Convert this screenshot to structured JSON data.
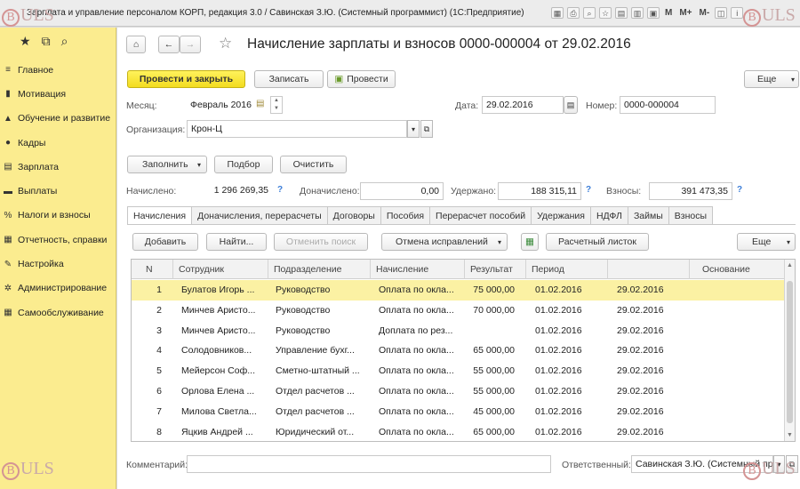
{
  "window": {
    "title": "Зарплата и управление персоналом КОРП, редакция 3.0 / Савинская З.Ю. (Системный программист)  (1С:Предприятие)",
    "toolbar_text": [
      "M",
      "M+",
      "M-"
    ]
  },
  "watermark": "ULS",
  "sidebar": {
    "items": [
      {
        "label": "Главное",
        "icon": "menu-icon"
      },
      {
        "label": "Мотивация",
        "icon": "chart-icon"
      },
      {
        "label": "Обучение и развитие",
        "icon": "graduation-icon"
      },
      {
        "label": "Кадры",
        "icon": "people-icon"
      },
      {
        "label": "Зарплата",
        "icon": "document-icon"
      },
      {
        "label": "Выплаты",
        "icon": "cash-icon"
      },
      {
        "label": "Налоги и взносы",
        "icon": "percent-icon"
      },
      {
        "label": "Отчетность, справки",
        "icon": "report-icon"
      },
      {
        "label": "Настройка",
        "icon": "wrench-icon"
      },
      {
        "label": "Администрирование",
        "icon": "gear-icon"
      },
      {
        "label": "Самообслуживание",
        "icon": "grid-icon"
      }
    ]
  },
  "header": {
    "title": "Начисление зарплаты и взносов 0000-000004 от 29.02.2016"
  },
  "actions": {
    "post_close": "Провести и закрыть",
    "save": "Записать",
    "post": "Провести",
    "more": "Еще"
  },
  "form": {
    "month_label": "Месяц:",
    "month_value": "Февраль 2016",
    "date_label": "Дата:",
    "date_value": "29.02.2016",
    "number_label": "Номер:",
    "number_value": "0000-000004",
    "org_label": "Организация:",
    "org_value": "Крон-Ц"
  },
  "fill_buttons": {
    "fill": "Заполнить",
    "select": "Подбор",
    "clear": "Очистить"
  },
  "totals": {
    "accrued_label": "Начислено:",
    "accrued_value": "1 296 269,35",
    "additional_label": "Доначислено:",
    "additional_value": "0,00",
    "withheld_label": "Удержано:",
    "withheld_value": "188 315,11",
    "contributions_label": "Взносы:",
    "contributions_value": "391 473,35",
    "help": "?"
  },
  "tabs": [
    "Начисления",
    "Доначисления, перерасчеты",
    "Договоры",
    "Пособия",
    "Перерасчет пособий",
    "Удержания",
    "НДФЛ",
    "Займы",
    "Взносы"
  ],
  "grid_toolbar": {
    "add": "Добавить",
    "find": "Найти...",
    "cancel_search": "Отменить поиск",
    "cancel_fixes": "Отмена исправлений",
    "payslip": "Расчетный листок",
    "more": "Еще"
  },
  "grid": {
    "columns": [
      "N",
      "Сотрудник",
      "Подразделение",
      "Начисление",
      "Результат",
      "Период",
      "",
      "Основание"
    ],
    "rows": [
      {
        "n": "1",
        "employee": "Булатов Игорь ...",
        "dept": "Руководство",
        "accrual": "Оплата по окла...",
        "result": "75 000,00",
        "period_from": "01.02.2016",
        "period_to": "29.02.2016",
        "basis": ""
      },
      {
        "n": "2",
        "employee": "Минчев Аристо...",
        "dept": "Руководство",
        "accrual": "Оплата по окла...",
        "result": "70 000,00",
        "period_from": "01.02.2016",
        "period_to": "29.02.2016",
        "basis": ""
      },
      {
        "n": "3",
        "employee": "Минчев Аристо...",
        "dept": "Руководство",
        "accrual": "Доплата по рез...",
        "result": "",
        "period_from": "01.02.2016",
        "period_to": "29.02.2016",
        "basis": ""
      },
      {
        "n": "4",
        "employee": "Солодовников...",
        "dept": "Управление бухг...",
        "accrual": "Оплата по окла...",
        "result": "65 000,00",
        "period_from": "01.02.2016",
        "period_to": "29.02.2016",
        "basis": ""
      },
      {
        "n": "5",
        "employee": "Мейерсон Соф...",
        "dept": "Сметно-штатный ...",
        "accrual": "Оплата по окла...",
        "result": "55 000,00",
        "period_from": "01.02.2016",
        "period_to": "29.02.2016",
        "basis": ""
      },
      {
        "n": "6",
        "employee": "Орлова Елена ...",
        "dept": "Отдел расчетов ...",
        "accrual": "Оплата по окла...",
        "result": "55 000,00",
        "period_from": "01.02.2016",
        "period_to": "29.02.2016",
        "basis": ""
      },
      {
        "n": "7",
        "employee": "Милова Светла...",
        "dept": "Отдел расчетов ...",
        "accrual": "Оплата по окла...",
        "result": "45 000,00",
        "period_from": "01.02.2016",
        "period_to": "29.02.2016",
        "basis": ""
      },
      {
        "n": "8",
        "employee": "Яцкив Андрей ...",
        "dept": "Юридический от...",
        "accrual": "Оплата по окла...",
        "result": "65 000,00",
        "period_from": "01.02.2016",
        "period_to": "29.02.2016",
        "basis": ""
      }
    ]
  },
  "footer": {
    "comment_label": "Комментарий:",
    "comment_value": "",
    "responsible_label": "Ответственный:",
    "responsible_value": "Савинская З.Ю. (Системный прог"
  },
  "colors": {
    "sidebar": "#fbec8f",
    "primary_button": "#f3dc1f",
    "selected_row": "#fbf1a3",
    "help_link": "#3b7dd8"
  }
}
